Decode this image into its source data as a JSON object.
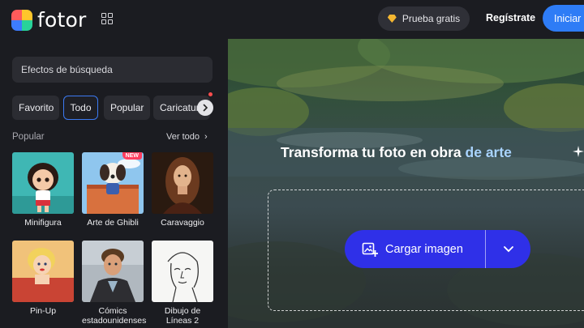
{
  "header": {
    "logo_text": "fotor",
    "trial_label": "Prueba gratis",
    "register_label": "Regístrate",
    "login_label": "Iniciar"
  },
  "sidebar": {
    "search_placeholder": "Efectos de búsqueda",
    "chips": [
      "Favorito",
      "Todo",
      "Popular",
      "Caricatura"
    ],
    "active_chip": "Todo",
    "section_title": "Popular",
    "see_all": "Ver todo",
    "new_badge": "NEW",
    "cards": [
      {
        "label": "Minifigura"
      },
      {
        "label": "Arte de Ghibli"
      },
      {
        "label": "Caravaggio"
      },
      {
        "label": "Pin-Up"
      },
      {
        "label": "Cómics estadounidenses"
      },
      {
        "label": "Dibujo de Líneas 2"
      }
    ]
  },
  "main": {
    "headline_start": "Transforma tu foto en obra ",
    "headline_accent": "de arte",
    "upload_label": "Cargar imagen"
  },
  "colors": {
    "accent": "#2e7cf6",
    "upload_button": "#2f30e8",
    "new_badge": "#ff3e5f",
    "active_chip_border": "#3c7af2"
  },
  "icons": [
    "apps-grid-icon",
    "diamond-icon",
    "chevron-right-icon",
    "image-add-icon",
    "chevron-down-icon",
    "sparkle-icon"
  ]
}
